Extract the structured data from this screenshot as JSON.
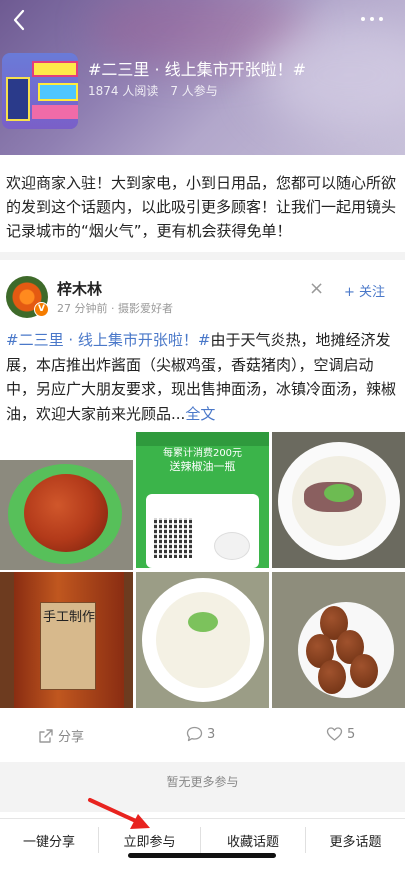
{
  "header": {
    "topic_title": "#二三里 · 线上集市开张啦！#",
    "reads": "1874 人阅读",
    "participants": "7 人参与"
  },
  "description": "欢迎商家入驻！大到家电，小到日用品，您都可以随心所欲的发到这个话题内，以此吸引更多顾客！让我们一起用镜头记录城市的“烟火气”，更有机会获得免单！",
  "post": {
    "username": "梓木林",
    "badge": "V",
    "meta": "27 分钟前 · 摄影爱好者",
    "close": "×",
    "follow": "+ 关注",
    "tag": "#二三里 · 线上集市开张啦！#",
    "body": "由于天气炎热，地摊经济发展，本店推出炸酱面（尖椒鸡蛋，香菇猪肉），空调启动中，另应广大朋友要求，现出售抻面汤，冰镇冷面汤，辣椒油，欢迎大家前来光顾品...",
    "full_link": "全文",
    "images": {
      "promo_line1": "每累计消费200元",
      "promo_line2": "送辣椒油一瓶",
      "jar_label": "手工制作"
    }
  },
  "actions": {
    "share": "分享",
    "comments": "3",
    "likes": "5"
  },
  "no_more": "暂无更多参与",
  "bottom_tabs": [
    "一键分享",
    "立即参与",
    "收藏话题",
    "更多话题"
  ],
  "colors": {
    "link": "#4a78c9",
    "annotation_arrow": "#e8231f"
  }
}
